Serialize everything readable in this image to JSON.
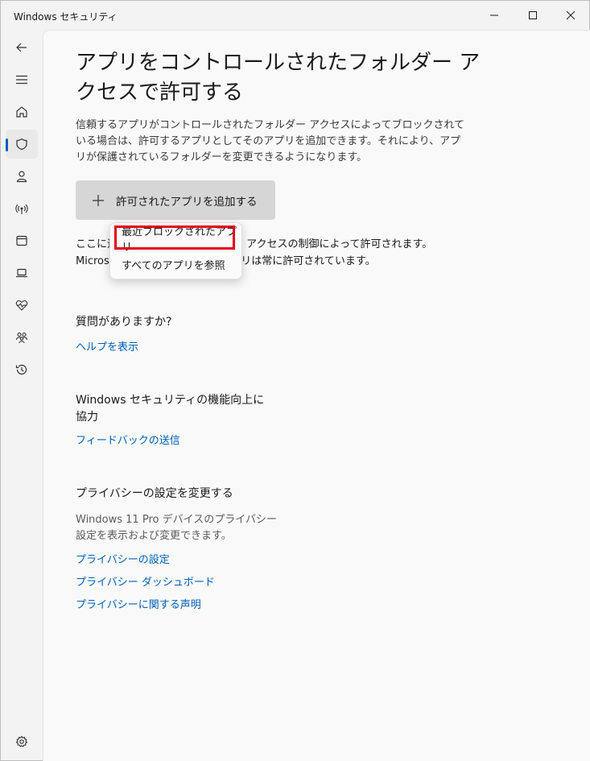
{
  "window": {
    "title": "Windows セキュリティ"
  },
  "page": {
    "title": "アプリをコントロールされたフォルダー アクセスで許可する",
    "description": "信頼するアプリがコントロールされたフォルダー アクセスによってブロックされている場合は、許可するアプリとしてそのアプリを追加できます。それにより、アプリが保護されているフォルダーを変更できるようになります。",
    "add_button_label": "許可されたアプリを追加する",
    "after_text": "ここに追加したアプリはフォルダー アクセスの制御によって許可されます。Microsoft によって許可されたアプリは常に許可されています。"
  },
  "flyout": {
    "items": [
      "最近ブロックされたアプリ",
      "すべてのアプリを参照"
    ]
  },
  "help": {
    "heading": "質問がありますか?",
    "link": "ヘルプを表示"
  },
  "feedback": {
    "heading": "Windows セキュリティの機能向上に協力",
    "link": "フィードバックの送信"
  },
  "privacy": {
    "heading": "プライバシーの設定を変更する",
    "text": "Windows 11 Pro デバイスのプライバシー設定を表示および変更できます。",
    "links": [
      "プライバシーの設定",
      "プライバシー ダッシュボード",
      "プライバシーに関する声明"
    ]
  },
  "colors": {
    "accent": "#005fb8",
    "highlight": "#e60012"
  },
  "nav_icons": [
    "back-icon",
    "menu-icon",
    "home-icon",
    "shield-icon",
    "account-icon",
    "network-icon",
    "app-browser-icon",
    "device-icon",
    "health-icon",
    "family-icon",
    "history-icon",
    "settings-icon"
  ]
}
